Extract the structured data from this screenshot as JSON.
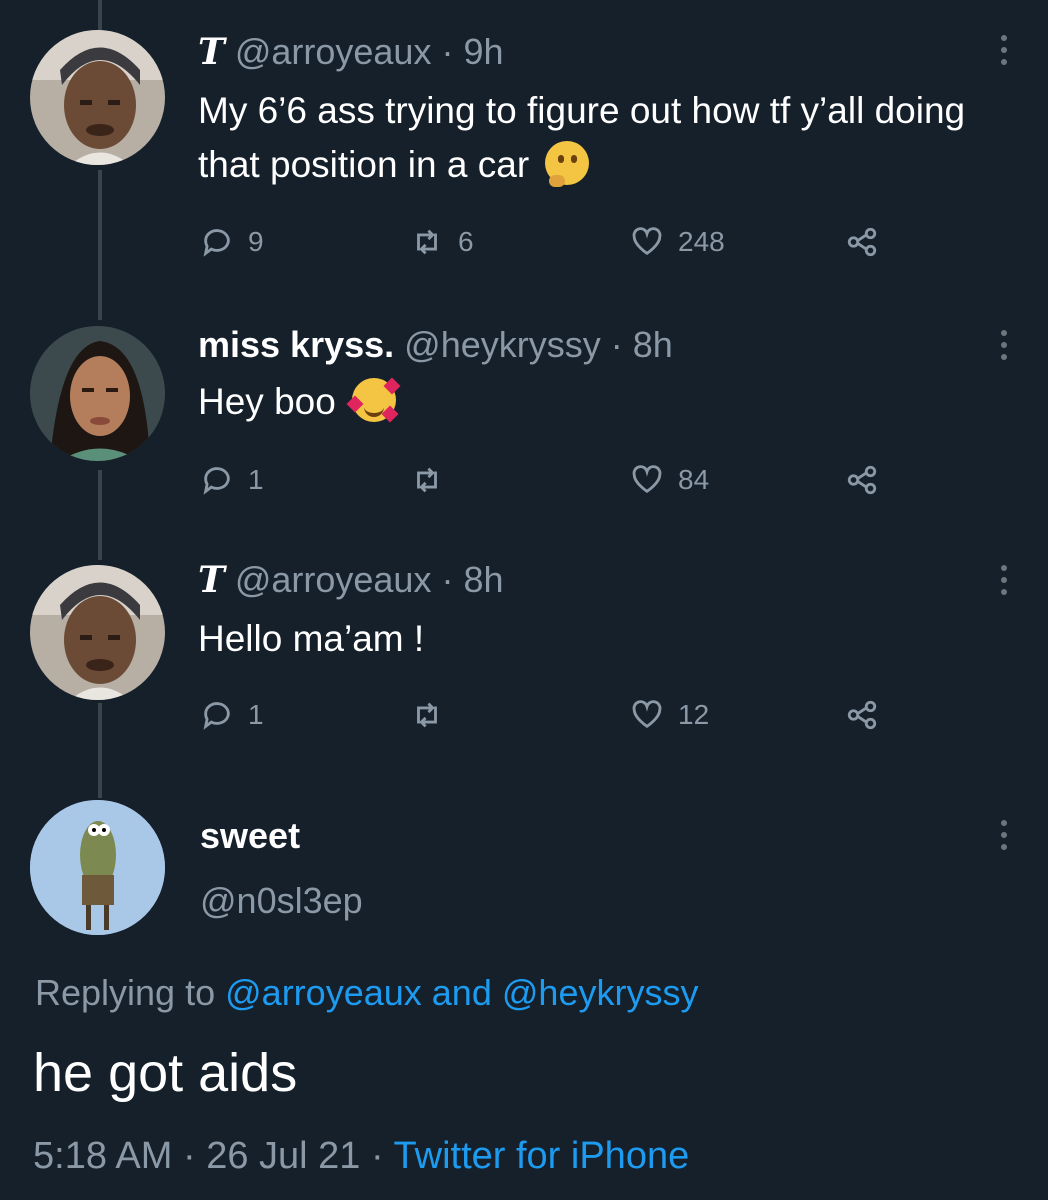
{
  "tweets": [
    {
      "display_name": "T",
      "handle": "@arroyeaux",
      "separator": "·",
      "time": "9h",
      "text": "My 6’6 ass trying to figure out how tf y’all doing that position in a car",
      "emoji": "thinking-face",
      "replies": "9",
      "retweets": "6",
      "likes": "248"
    },
    {
      "display_name": "miss kryss.",
      "handle": "@heykryssy",
      "separator": "·",
      "time": "8h",
      "text": "Hey boo",
      "emoji": "smiling-face-with-hearts",
      "replies": "1",
      "retweets": "",
      "likes": "84"
    },
    {
      "display_name": "T",
      "handle": "@arroyeaux",
      "separator": "·",
      "time": "8h",
      "text": "Hello ma’am !",
      "replies": "1",
      "retweets": "",
      "likes": "12"
    }
  ],
  "focused_tweet": {
    "display_name": "sweet",
    "handle": "@n0sl3ep",
    "replying_prefix": "Replying to",
    "replying_user_1": "@arroyeaux",
    "replying_and": "and",
    "replying_user_2": "@heykryssy",
    "text": "he got aids",
    "time": "5:18 AM",
    "separator_1": "·",
    "date": "26 Jul 21",
    "separator_2": "·",
    "source": "Twitter for iPhone"
  },
  "colors": {
    "background": "#15202b",
    "accent": "#1d9bf0",
    "muted": "#8b98a5"
  }
}
